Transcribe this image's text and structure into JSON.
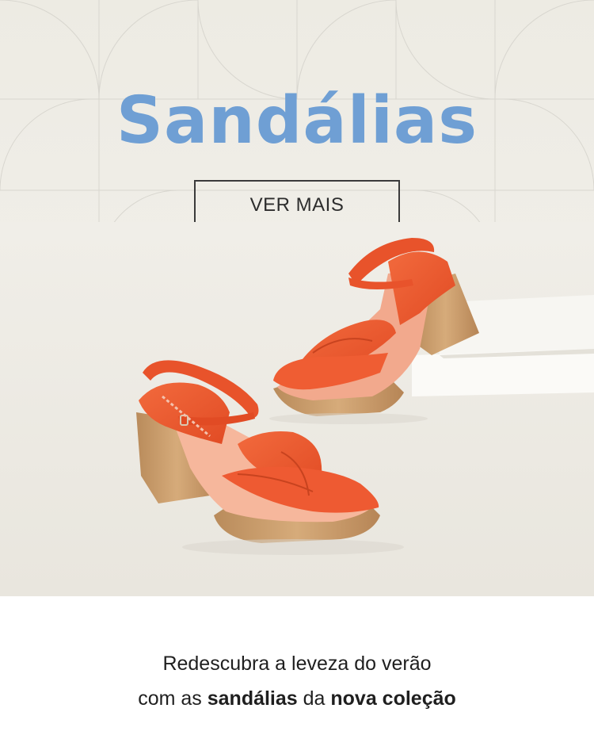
{
  "hero": {
    "title": "Sandálias",
    "cta_label": "VER MAIS",
    "product_image": "orange-block-heel-sandals",
    "colors": {
      "title": "#6f9fd4",
      "background": "#eeece5",
      "sandal": "#ee5a32",
      "heel": "#c99c6a"
    }
  },
  "tagline": {
    "line1": "Redescubra a leveza do verão",
    "line2_prefix": "com as ",
    "line2_bold1": "sandálias",
    "line2_mid": " da ",
    "line2_bold2": "nova coleção"
  }
}
